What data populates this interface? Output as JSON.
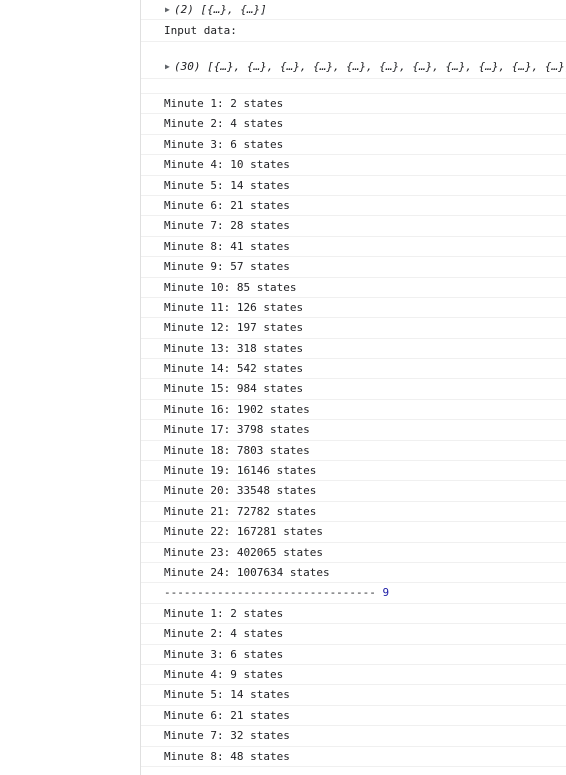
{
  "console": {
    "top_array": {
      "arrow": "▶",
      "text": "(2) [{…}, {…}]"
    },
    "input_label": "Input data:",
    "input_array": {
      "arrow": "▶",
      "text": "(30) [{…}, {…}, {…}, {…}, {…}, {…}, {…}, {…}, {…}, {…}, {…}, {…}"
    },
    "run1": [
      "Minute 1: 2 states",
      "Minute 2: 4 states",
      "Minute 3: 6 states",
      "Minute 4: 10 states",
      "Minute 5: 14 states",
      "Minute 6: 21 states",
      "Minute 7: 28 states",
      "Minute 8: 41 states",
      "Minute 9: 57 states",
      "Minute 10: 85 states",
      "Minute 11: 126 states",
      "Minute 12: 197 states",
      "Minute 13: 318 states",
      "Minute 14: 542 states",
      "Minute 15: 984 states",
      "Minute 16: 1902 states",
      "Minute 17: 3798 states",
      "Minute 18: 7803 states",
      "Minute 19: 16146 states",
      "Minute 20: 33548 states",
      "Minute 21: 72782 states",
      "Minute 22: 167281 states",
      "Minute 23: 402065 states",
      "Minute 24: 1007634 states"
    ],
    "separator": {
      "dashes": "--------------------------------",
      "value": "9"
    },
    "run2": [
      "Minute 1: 2 states",
      "Minute 2: 4 states",
      "Minute 3: 6 states",
      "Minute 4: 9 states",
      "Minute 5: 14 states",
      "Minute 6: 21 states",
      "Minute 7: 32 states",
      "Minute 8: 48 states"
    ]
  }
}
